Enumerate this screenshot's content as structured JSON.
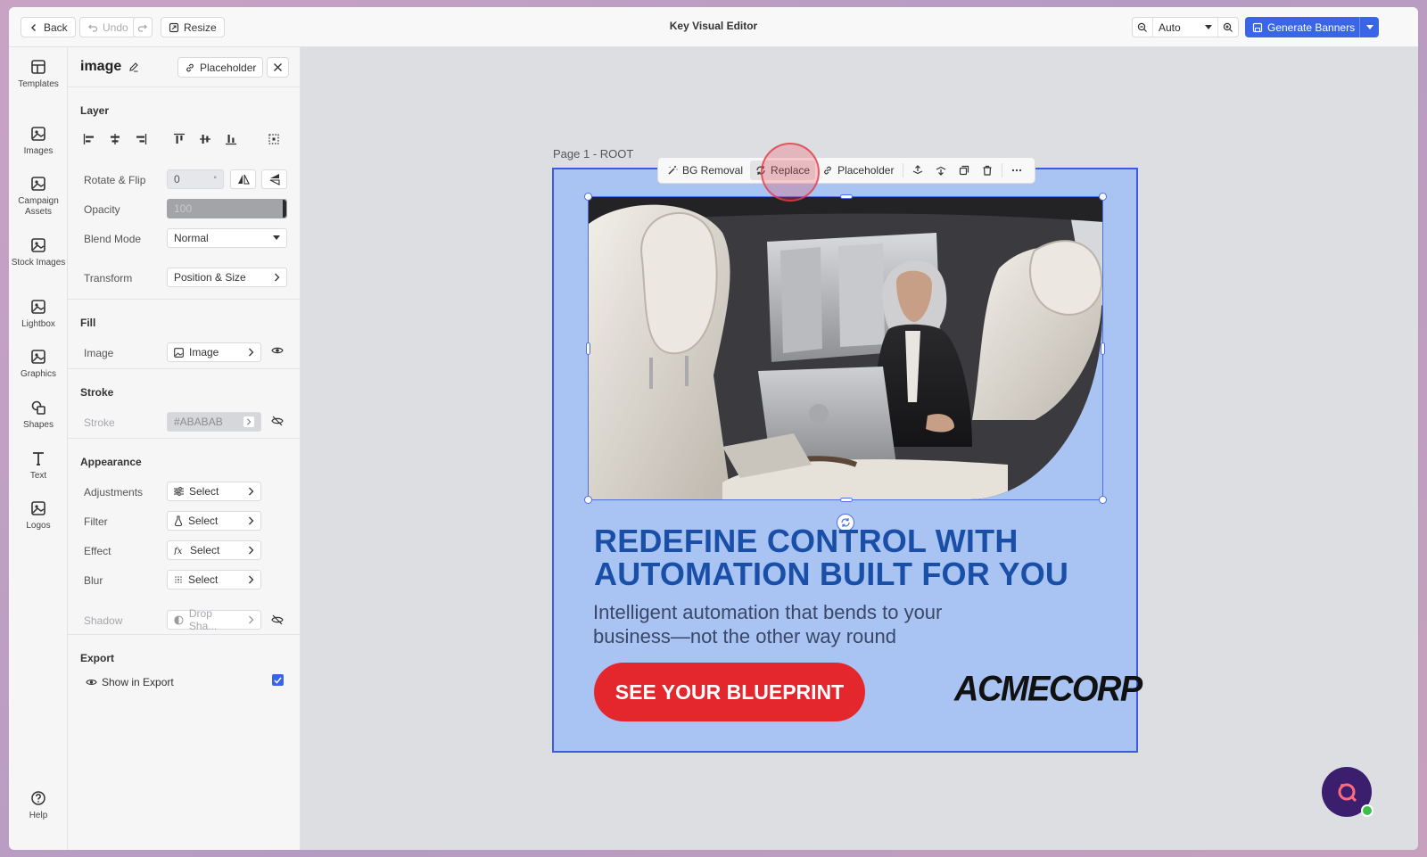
{
  "topbar": {
    "back_label": "Back",
    "undo_label": "Undo",
    "resize_label": "Resize",
    "title": "Key Visual Editor",
    "zoom_value": "Auto",
    "generate_label": "Generate Banners"
  },
  "rail": {
    "items": [
      {
        "label": "Templates",
        "icon": "layout-icon"
      },
      {
        "label": "Images",
        "icon": "image-icon"
      },
      {
        "label": "Campaign Assets",
        "icon": "image-icon"
      },
      {
        "label": "Stock Images",
        "icon": "image-icon"
      },
      {
        "label": "Lightbox",
        "icon": "image-icon"
      },
      {
        "label": "Graphics",
        "icon": "image-icon"
      },
      {
        "label": "Shapes",
        "icon": "shapes-icon"
      },
      {
        "label": "Text",
        "icon": "text-icon"
      },
      {
        "label": "Logos",
        "icon": "image-icon"
      }
    ],
    "help_label": "Help"
  },
  "panel": {
    "title": "image",
    "placeholder_label": "Placeholder",
    "layer": {
      "title": "Layer",
      "rotate_label": "Rotate & Flip",
      "rotate_value": "0",
      "rotate_unit": "°",
      "opacity_label": "Opacity",
      "opacity_value": "100",
      "blend_label": "Blend Mode",
      "blend_value": "Normal",
      "transform_label": "Transform",
      "transform_value": "Position & Size"
    },
    "fill": {
      "title": "Fill",
      "image_label": "Image",
      "image_value": "Image"
    },
    "stroke": {
      "title": "Stroke",
      "stroke_label": "Stroke",
      "stroke_value": "#ABABAB"
    },
    "appearance": {
      "title": "Appearance",
      "adjustments_label": "Adjustments",
      "filter_label": "Filter",
      "effect_label": "Effect",
      "blur_label": "Blur",
      "select_value": "Select",
      "shadow_label": "Shadow",
      "shadow_value": "Drop Sha..."
    },
    "export": {
      "title": "Export",
      "show_label": "Show in Export",
      "checked": true
    }
  },
  "canvas": {
    "page_label": "Page 1 - ROOT",
    "toolbar": {
      "bg_removal": "BG Removal",
      "replace": "Replace",
      "placeholder": "Placeholder"
    },
    "banner": {
      "headline": "REDEFINE CONTROL WITH AUTOMATION BUILT FOR YOU",
      "subline": "Intelligent automation that bends to your business—not the other way round",
      "cta": "SEE YOUR BLUEPRINT",
      "logo": "ACMECORP",
      "bg_color": "#a9c3f3",
      "headline_color": "#1a4fa8",
      "cta_color": "#e3272d"
    }
  },
  "colors": {
    "accent": "#3866e6",
    "selection": "#4e6fe6"
  }
}
